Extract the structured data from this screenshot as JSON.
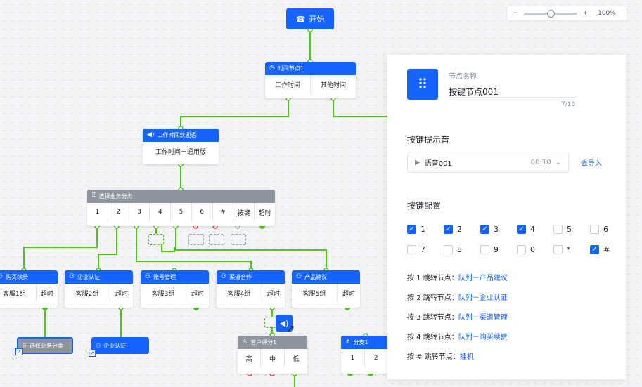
{
  "zoom": {
    "minus": "−",
    "plus": "+",
    "level": "100%",
    "level_fraction": 0.5
  },
  "flow": {
    "start": {
      "label": "开始",
      "icon": "phone-icon"
    },
    "time_node": {
      "title": "时间节点1",
      "branches": [
        "工作时间",
        "其他时间"
      ]
    },
    "greeting": {
      "title": "工作时间欢迎语",
      "body": "工作时间－通用版"
    },
    "menu": {
      "title": "选择业务分类",
      "keys": [
        "1",
        "2",
        "3",
        "4",
        "5",
        "6",
        "#",
        "按键",
        "超时"
      ]
    },
    "groups": [
      {
        "title": "购买续费",
        "cells": [
          "客服1组",
          "超时"
        ]
      },
      {
        "title": "企业认证",
        "cells": [
          "客服2组",
          "超时"
        ]
      },
      {
        "title": "账号管理",
        "cells": [
          "客服3组",
          "超时"
        ]
      },
      {
        "title": "渠道合作",
        "cells": [
          "客服4组",
          "超时"
        ]
      },
      {
        "title": "产品建议",
        "cells": [
          "客服5组",
          "超时"
        ]
      }
    ],
    "select_node": {
      "label": "选择业务分类"
    },
    "auth_node": {
      "label": "企业认证"
    },
    "rating": {
      "title": "客户评分1",
      "cells": [
        "高",
        "中",
        "低"
      ]
    },
    "branch": {
      "title": "分支1",
      "cells": [
        "1",
        "2"
      ]
    }
  },
  "panel": {
    "name_label": "节点名称",
    "name_value": "按键节点001",
    "name_count": "7/10",
    "prompt_title": "按键提示音",
    "audio_name": "语音001",
    "audio_time": "00:10",
    "import_link": "去导入",
    "config_title": "按键配置",
    "keys": [
      {
        "key": "1",
        "checked": true
      },
      {
        "key": "2",
        "checked": true
      },
      {
        "key": "3",
        "checked": true
      },
      {
        "key": "4",
        "checked": true
      },
      {
        "key": "5",
        "checked": false
      },
      {
        "key": "6",
        "checked": false
      },
      {
        "key": "7",
        "checked": false
      },
      {
        "key": "8",
        "checked": false
      },
      {
        "key": "9",
        "checked": false
      },
      {
        "key": "0",
        "checked": false
      },
      {
        "key": "*",
        "checked": false
      },
      {
        "key": "#",
        "checked": true
      }
    ],
    "jumps": [
      {
        "label": "按 1 跳转节点：",
        "value": "队列－产品建议"
      },
      {
        "label": "按 2 跳转节点：",
        "value": "队列－企业认证"
      },
      {
        "label": "按 3 跳转节点：",
        "value": "队列－渠道管理"
      },
      {
        "label": "按 4 跳转节点：",
        "value": "队列－购买续费"
      },
      {
        "label": "按 # 跳转节点：",
        "value": "挂机"
      }
    ]
  },
  "colors": {
    "accent": "#1664ff",
    "edge": "#52c41a",
    "danger": "#f53f3f",
    "muted_header": "#8f959e"
  }
}
